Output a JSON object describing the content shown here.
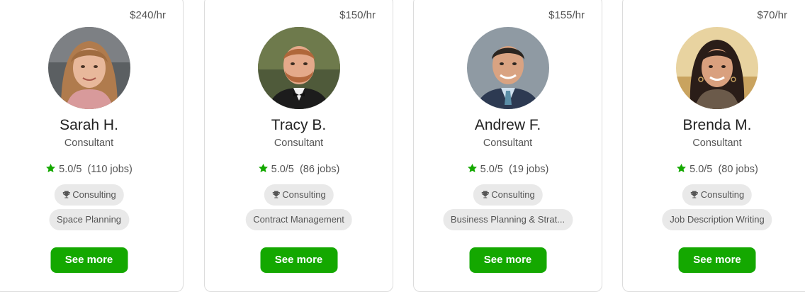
{
  "cards": [
    {
      "rate": "$240/hr",
      "name": "Sarah H.",
      "title": "Consultant",
      "rating": "5.0/5",
      "jobs": "(110 jobs)",
      "category": "Consulting",
      "skill": "Space Planning",
      "button": "See more"
    },
    {
      "rate": "$150/hr",
      "name": "Tracy B.",
      "title": "Consultant",
      "rating": "5.0/5",
      "jobs": "(86 jobs)",
      "category": "Consulting",
      "skill": "Contract Management",
      "button": "See more"
    },
    {
      "rate": "$155/hr",
      "name": "Andrew F.",
      "title": "Consultant",
      "rating": "5.0/5",
      "jobs": "(19 jobs)",
      "category": "Consulting",
      "skill": "Business Planning & Strat...",
      "button": "See more"
    },
    {
      "rate": "$70/hr",
      "name": "Brenda M.",
      "title": "Consultant",
      "rating": "5.0/5",
      "jobs": "(80 jobs)",
      "category": "Consulting",
      "skill": "Job Description Writing",
      "button": "See more"
    }
  ],
  "colors": {
    "accent": "#14a800",
    "pill_bg": "#e9e9e9",
    "border": "#dcdcdc"
  }
}
